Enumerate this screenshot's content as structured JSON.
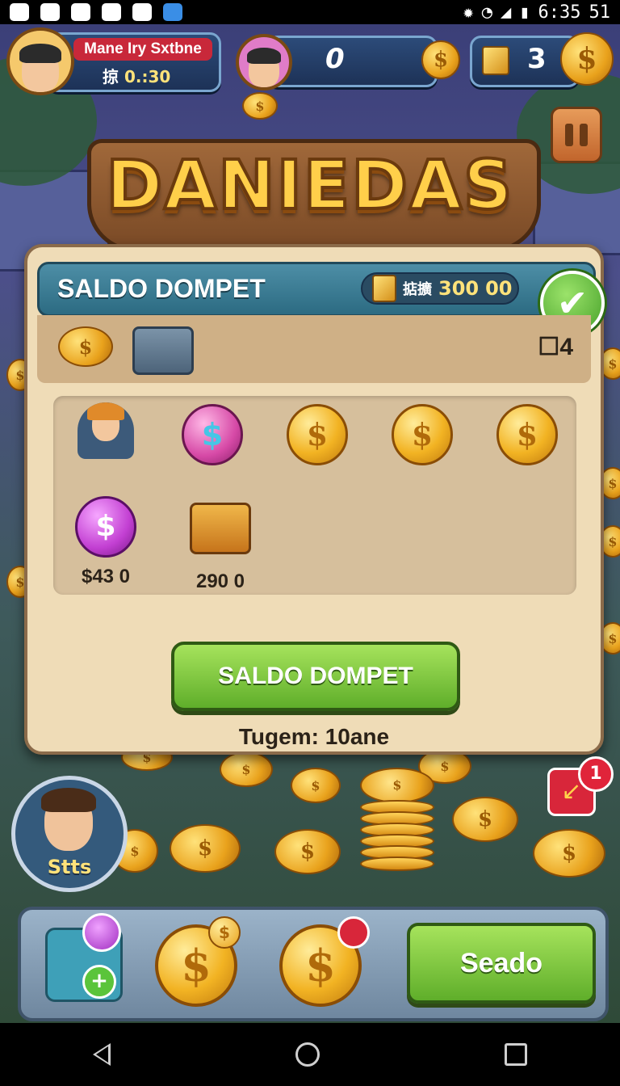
{
  "status_bar": {
    "time": "6:35",
    "battery": "51",
    "icons": [
      "app-icon",
      "sync-icon",
      "close-icon",
      "bag-icon",
      "camera-icon",
      "dropbox-icon",
      "settings-icon",
      "wifi-icon",
      "signal-icon",
      "battery-icon"
    ]
  },
  "profile": {
    "name": "Mane Iry Sxtbne",
    "sub_prefix": "掠",
    "sub_value": "0.:30"
  },
  "top_counter": {
    "value": "0"
  },
  "top_right": {
    "count": "3"
  },
  "banner": {
    "title": "DANIEDAS"
  },
  "panel": {
    "title": "SALDO DOMPET",
    "balance_prefix": "掂擴",
    "balance_value": "300",
    "balance_cents": "00",
    "strip_count": "4",
    "items": [
      {
        "icon": "character-icon",
        "label": ""
      },
      {
        "icon": "pink-dollar-coin-icon",
        "label": ""
      },
      {
        "icon": "gold-coin-icon",
        "label": ""
      },
      {
        "icon": "gold-coin-icon",
        "label": ""
      },
      {
        "icon": "gold-coin-icon",
        "label": ""
      },
      {
        "icon": "purple-dollar-coin-icon",
        "label": "$43 0"
      },
      {
        "icon": "cash-box-icon",
        "label": "290 0"
      }
    ],
    "button_label": "SALDO DOMPET",
    "footnote": "Tugem: 10ane"
  },
  "player_badge": {
    "label": "Stts"
  },
  "notification": {
    "count": "1"
  },
  "bottom_bar": {
    "button_label": "Seado"
  },
  "colors": {
    "gold": "#f2b323",
    "green_button": "#5fae2a",
    "panel_header": "#2c6b82",
    "panel_bg": "#efdcb7"
  }
}
